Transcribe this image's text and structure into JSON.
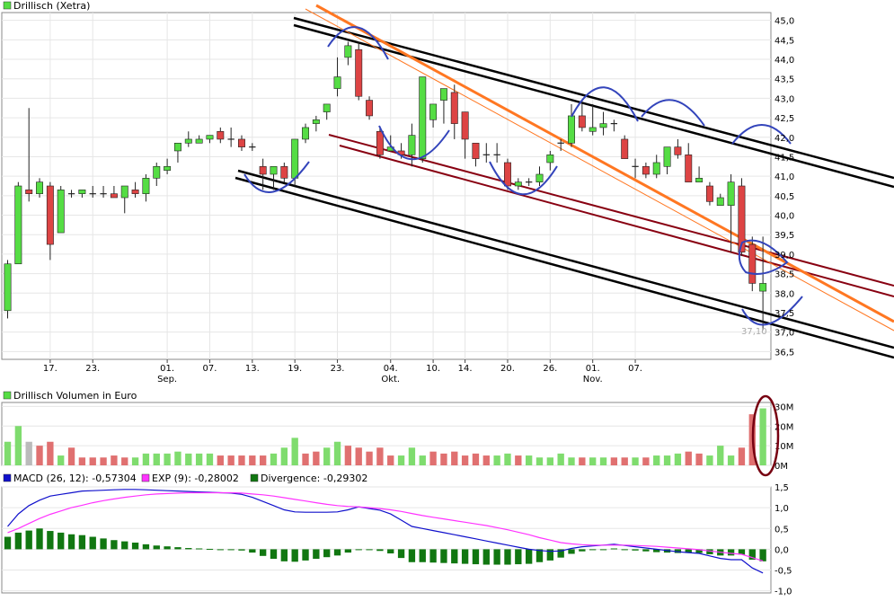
{
  "colors": {
    "up": "#55dd44",
    "down": "#dd4444",
    "up_vol": "#7fdc6e",
    "down_vol": "#e07070",
    "neutral_vol": "#bbbbbb",
    "grid": "#e6e6e6",
    "frame": "#888888",
    "macd": "#1010cc",
    "signal": "#ff33ff",
    "divergence": "#117711",
    "trend_black": "#000000",
    "trend_red": "#880011",
    "trend_orange": "#ff7722",
    "annotation": "#3344bb"
  },
  "panels": {
    "price": {
      "legend": "Drillisch (Xetra)",
      "last_label": "37,10"
    },
    "volume": {
      "legend": "Drillisch Volumen in Euro"
    },
    "macd": {
      "legend_macd": "MACD (26, 12): -0,57304",
      "legend_exp": "EXP (9): -0,28002",
      "legend_div": "Divergence: -0,29302"
    }
  },
  "x_axis": {
    "ticks": [
      "17.",
      "23.",
      "01.",
      "07.",
      "13.",
      "19.",
      "23.",
      "04.",
      "10.",
      "14.",
      "20.",
      "26.",
      "01.",
      "07."
    ],
    "months": [
      "Sep.",
      "Okt.",
      "Nov."
    ]
  },
  "chart_data": [
    {
      "type": "candlestick",
      "title": "Drillisch (Xetra)",
      "y_ticks": [
        "45,0",
        "44,5",
        "44,0",
        "43,5",
        "43,0",
        "42,5",
        "42,0",
        "41,5",
        "41,0",
        "40,5",
        "40,0",
        "39,5",
        "39,0",
        "38,5",
        "38,0",
        "37,5",
        "37,0",
        "36,5"
      ],
      "ylim": [
        36.3,
        45.2
      ],
      "ohlc": [
        [
          37.55,
          38.85,
          37.35,
          38.75
        ],
        [
          38.75,
          40.85,
          38.75,
          40.75
        ],
        [
          40.65,
          42.75,
          40.35,
          40.55
        ],
        [
          40.55,
          40.95,
          40.45,
          40.85
        ],
        [
          40.75,
          40.85,
          38.85,
          39.25
        ],
        [
          39.55,
          40.75,
          39.55,
          40.65
        ],
        [
          40.55,
          40.65,
          40.45,
          40.55
        ],
        [
          40.55,
          40.65,
          40.45,
          40.65
        ],
        [
          40.55,
          40.75,
          40.45,
          40.55
        ],
        [
          40.55,
          40.75,
          40.45,
          40.55
        ],
        [
          40.55,
          40.75,
          40.45,
          40.45
        ],
        [
          40.45,
          40.75,
          40.05,
          40.75
        ],
        [
          40.65,
          40.85,
          40.45,
          40.55
        ],
        [
          40.55,
          41.05,
          40.35,
          40.95
        ],
        [
          40.95,
          41.35,
          40.75,
          41.25
        ],
        [
          41.15,
          41.45,
          41.05,
          41.25
        ],
        [
          41.65,
          41.85,
          41.35,
          41.85
        ],
        [
          41.85,
          42.15,
          41.75,
          41.95
        ],
        [
          41.85,
          42.05,
          41.85,
          41.95
        ],
        [
          41.95,
          42.05,
          41.85,
          42.05
        ],
        [
          42.15,
          42.25,
          41.85,
          41.95
        ],
        [
          41.95,
          42.25,
          41.75,
          41.95
        ],
        [
          41.95,
          42.05,
          41.65,
          41.75
        ],
        [
          41.75,
          41.85,
          41.65,
          41.75
        ],
        [
          41.25,
          41.45,
          40.65,
          41.05
        ],
        [
          41.05,
          41.25,
          40.65,
          41.25
        ],
        [
          41.25,
          41.35,
          40.85,
          40.95
        ],
        [
          40.95,
          41.85,
          40.75,
          41.95
        ],
        [
          41.95,
          42.35,
          41.85,
          42.25
        ],
        [
          42.35,
          42.55,
          42.15,
          42.45
        ],
        [
          42.65,
          42.85,
          42.45,
          42.85
        ],
        [
          43.25,
          44.05,
          43.05,
          43.55
        ],
        [
          44.05,
          44.45,
          43.85,
          44.35
        ],
        [
          44.25,
          44.45,
          42.95,
          43.05
        ],
        [
          42.95,
          43.05,
          42.45,
          42.55
        ],
        [
          42.15,
          42.25,
          41.45,
          41.55
        ],
        [
          41.65,
          42.05,
          41.65,
          41.75
        ],
        [
          41.65,
          41.85,
          41.45,
          41.55
        ],
        [
          41.55,
          42.35,
          41.25,
          42.05
        ],
        [
          41.45,
          43.55,
          41.35,
          43.55
        ],
        [
          42.45,
          42.85,
          42.25,
          42.85
        ],
        [
          42.95,
          43.25,
          42.35,
          43.25
        ],
        [
          43.15,
          43.35,
          41.95,
          42.35
        ],
        [
          42.65,
          42.65,
          41.45,
          41.95
        ],
        [
          41.85,
          41.85,
          41.25,
          41.45
        ],
        [
          41.55,
          41.85,
          41.35,
          41.55
        ],
        [
          41.55,
          41.85,
          41.35,
          41.55
        ],
        [
          41.35,
          41.45,
          40.65,
          40.75
        ],
        [
          40.75,
          40.95,
          40.65,
          40.85
        ],
        [
          40.85,
          40.95,
          40.75,
          40.85
        ],
        [
          40.85,
          41.25,
          40.75,
          41.05
        ],
        [
          41.35,
          41.65,
          41.15,
          41.55
        ],
        [
          41.85,
          41.95,
          41.65,
          41.85
        ],
        [
          41.85,
          42.85,
          41.75,
          42.55
        ],
        [
          42.55,
          42.95,
          42.15,
          42.25
        ],
        [
          42.15,
          42.85,
          42.05,
          42.25
        ],
        [
          42.25,
          42.65,
          42.05,
          42.35
        ],
        [
          42.35,
          42.45,
          42.15,
          42.35
        ],
        [
          41.95,
          42.05,
          41.45,
          41.45
        ],
        [
          41.25,
          41.45,
          40.95,
          41.25
        ],
        [
          41.25,
          41.35,
          40.95,
          41.05
        ],
        [
          41.05,
          41.55,
          40.95,
          41.35
        ],
        [
          41.25,
          41.75,
          41.05,
          41.75
        ],
        [
          41.75,
          41.95,
          41.45,
          41.55
        ],
        [
          41.55,
          41.85,
          40.85,
          40.85
        ],
        [
          40.85,
          41.25,
          40.85,
          40.95
        ],
        [
          40.75,
          40.85,
          40.25,
          40.35
        ],
        [
          40.25,
          40.55,
          40.25,
          40.45
        ],
        [
          40.25,
          41.05,
          39.05,
          40.85
        ],
        [
          40.75,
          40.95,
          38.95,
          39.05
        ],
        [
          39.25,
          39.45,
          38.05,
          38.25
        ],
        [
          38.05,
          39.45,
          37.05,
          38.25
        ]
      ]
    },
    {
      "type": "bar",
      "title": "Drillisch Volumen in Euro",
      "y_ticks": [
        "30M",
        "20M",
        "10M",
        "0M"
      ],
      "ylim": [
        0,
        32
      ],
      "values": [
        12,
        20,
        12,
        10,
        12,
        5,
        9,
        4,
        4,
        4,
        5,
        4,
        4,
        6,
        6,
        6,
        7,
        6,
        6,
        6,
        5,
        5,
        5,
        5,
        5,
        6,
        9,
        14,
        6,
        7,
        9,
        12,
        10,
        9,
        7,
        9,
        5,
        5,
        9,
        5,
        7,
        6,
        7,
        5,
        6,
        5,
        5,
        6,
        5,
        5,
        4,
        4,
        6,
        4,
        4,
        4,
        4,
        4,
        4,
        4,
        4,
        5,
        5,
        6,
        7,
        6,
        5,
        10,
        5,
        9,
        26,
        29
      ],
      "direction": [
        "up",
        "up",
        "neutral",
        "down",
        "down",
        "up",
        "down",
        "down",
        "down",
        "down",
        "down",
        "down",
        "up",
        "up",
        "up",
        "up",
        "up",
        "up",
        "up",
        "up",
        "down",
        "down",
        "down",
        "down",
        "down",
        "up",
        "up",
        "up",
        "down",
        "down",
        "up",
        "up",
        "down",
        "down",
        "down",
        "down",
        "down",
        "up",
        "up",
        "up",
        "down",
        "down",
        "down",
        "down",
        "down",
        "down",
        "up",
        "up",
        "down",
        "up",
        "up",
        "up",
        "up",
        "up",
        "down",
        "up",
        "up",
        "down",
        "down",
        "up",
        "down",
        "up",
        "up",
        "up",
        "down",
        "down",
        "up",
        "up",
        "up",
        "down",
        "down",
        "up"
      ]
    },
    {
      "type": "line",
      "title": "MACD (26, 12)",
      "y_ticks": [
        "1,5",
        "1,0",
        "0,5",
        "0,0",
        "-0,5",
        "-1,0"
      ],
      "ylim": [
        -1.05,
        1.5
      ],
      "series": [
        {
          "name": "MACD (26, 12)",
          "values": [
            0.55,
            0.85,
            1.05,
            1.18,
            1.28,
            1.32,
            1.36,
            1.4,
            1.41,
            1.42,
            1.43,
            1.44,
            1.44,
            1.43,
            1.42,
            1.41,
            1.4,
            1.39,
            1.38,
            1.37,
            1.36,
            1.35,
            1.32,
            1.25,
            1.15,
            1.05,
            0.95,
            0.9,
            0.89,
            0.89,
            0.89,
            0.9,
            0.95,
            1.02,
            0.98,
            0.94,
            0.85,
            0.7,
            0.55,
            0.5,
            0.45,
            0.4,
            0.35,
            0.3,
            0.25,
            0.2,
            0.15,
            0.1,
            0.05,
            0.0,
            -0.03,
            -0.05,
            -0.04,
            0.02,
            0.06,
            0.08,
            0.1,
            0.12,
            0.09,
            0.06,
            0.03,
            0.0,
            -0.03,
            -0.06,
            -0.08,
            -0.1,
            -0.16,
            -0.22,
            -0.25,
            -0.25,
            -0.45,
            -0.57
          ]
        },
        {
          "name": "EXP (9)",
          "values": [
            0.4,
            0.5,
            0.62,
            0.74,
            0.84,
            0.92,
            1.0,
            1.06,
            1.12,
            1.17,
            1.21,
            1.25,
            1.28,
            1.31,
            1.33,
            1.34,
            1.35,
            1.36,
            1.36,
            1.36,
            1.36,
            1.36,
            1.35,
            1.33,
            1.31,
            1.28,
            1.24,
            1.2,
            1.16,
            1.12,
            1.08,
            1.05,
            1.03,
            1.02,
            1.0,
            0.98,
            0.95,
            0.91,
            0.86,
            0.81,
            0.77,
            0.73,
            0.69,
            0.65,
            0.61,
            0.57,
            0.52,
            0.47,
            0.41,
            0.35,
            0.28,
            0.22,
            0.16,
            0.13,
            0.11,
            0.1,
            0.1,
            0.1,
            0.1,
            0.09,
            0.08,
            0.07,
            0.05,
            0.03,
            0.01,
            -0.01,
            -0.04,
            -0.07,
            -0.1,
            -0.12,
            -0.2,
            -0.28
          ]
        }
      ]
    },
    {
      "type": "bar",
      "title": "Divergence",
      "ylim": [
        -1.05,
        1.5
      ],
      "values": [
        0.3,
        0.4,
        0.45,
        0.5,
        0.44,
        0.4,
        0.36,
        0.34,
        0.3,
        0.26,
        0.22,
        0.19,
        0.16,
        0.12,
        0.09,
        0.07,
        0.05,
        0.03,
        0.02,
        0.01,
        0.0,
        -0.01,
        -0.03,
        -0.08,
        -0.16,
        -0.23,
        -0.29,
        -0.3,
        -0.27,
        -0.23,
        -0.19,
        -0.15,
        -0.08,
        -0.01,
        -0.02,
        -0.04,
        -0.1,
        -0.21,
        -0.31,
        -0.31,
        -0.32,
        -0.33,
        -0.34,
        -0.35,
        -0.36,
        -0.37,
        -0.37,
        -0.37,
        -0.36,
        -0.35,
        -0.31,
        -0.27,
        -0.2,
        -0.11,
        -0.05,
        -0.02,
        0.0,
        0.02,
        -0.01,
        -0.03,
        -0.05,
        -0.07,
        -0.08,
        -0.09,
        -0.09,
        -0.09,
        -0.12,
        -0.15,
        -0.15,
        -0.13,
        -0.25,
        -0.29
      ]
    }
  ]
}
